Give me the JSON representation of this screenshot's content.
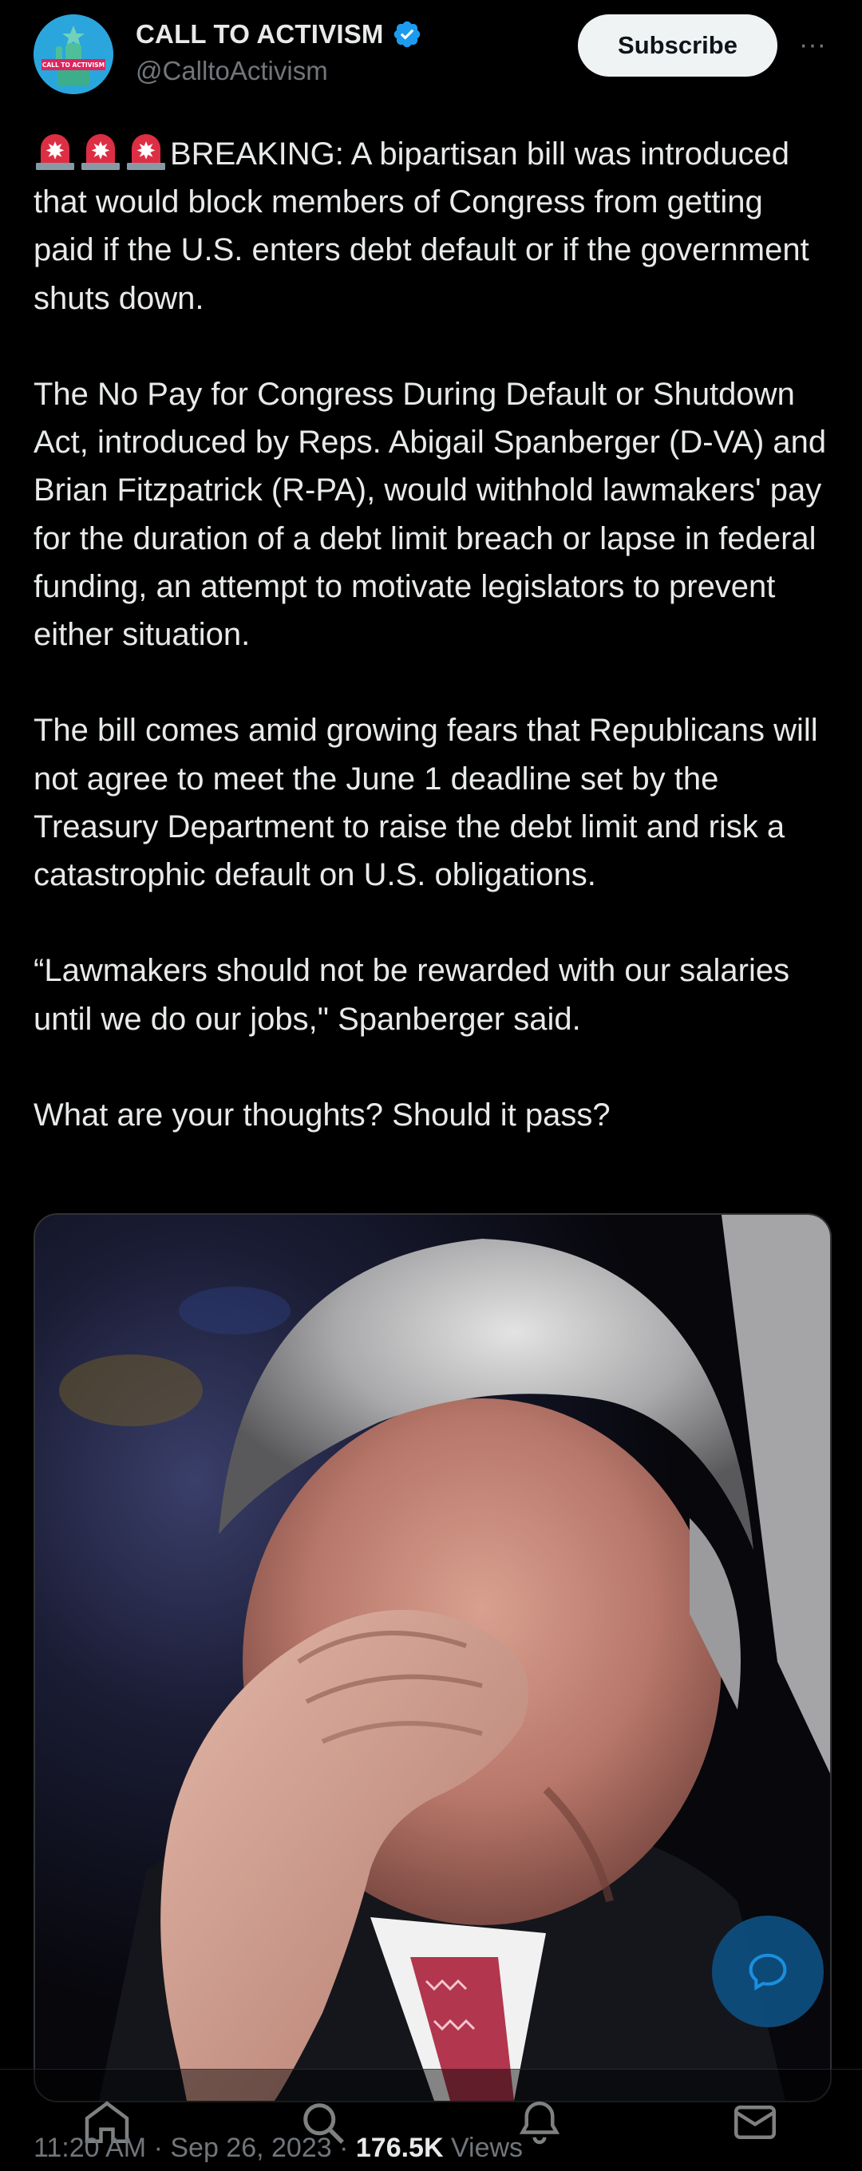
{
  "account": {
    "display_name": "CALL TO ACTIVISM",
    "handle": "@CalltoActivism",
    "avatar_text": "CALL TO ACTIVISM",
    "verified_color": "#1d9bf0"
  },
  "header": {
    "subscribe_label": "Subscribe",
    "more_label": "···"
  },
  "tweet": {
    "p1": "BREAKING: A bipartisan bill was introduced that would block members of Congress from getting paid if the U.S. enters debt default or if the government shuts down.",
    "p2": "The No Pay for Congress During Default or Shutdown Act, introduced by Reps. Abigail Spanberger (D-VA) and Brian Fitzpatrick (R-PA), would withhold lawmakers' pay for the duration of a debt limit breach or lapse in federal funding, an attempt to motivate legislators to prevent either situation.",
    "p3": "The bill comes amid growing fears that Republicans will not agree to meet the June 1 deadline set by the Treasury Department to raise the debt limit and risk a catastrophic default on U.S. obligations.",
    "p4": "“Lawmakers should not be rewarded with our salaries until we do our jobs,\" Spanberger said.",
    "p5": "What are your thoughts? Should it pass?"
  },
  "meta": {
    "time": "11:20 AM",
    "separator": " · ",
    "date": "Sep 26, 2023",
    "views_count": "176.5K",
    "views_label": "Views"
  },
  "colors": {
    "background": "#000000",
    "text": "#e7e9ea",
    "secondary": "#71767b",
    "accent": "#1d9bf0"
  },
  "icons": [
    "siren-icon",
    "verified-badge-icon",
    "more-icon",
    "reply-fab-icon",
    "home-icon",
    "search-icon",
    "notifications-icon",
    "messages-icon"
  ]
}
